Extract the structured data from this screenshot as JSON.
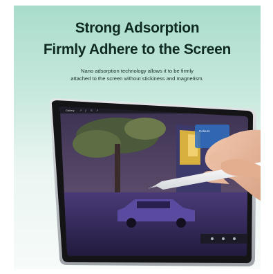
{
  "banner": {
    "headline_line1": "Strong Adsorption",
    "headline_line2": "Firmly Adhere to the Screen",
    "subtitle_line1": "Nano adsorption technology allows it to be firmly",
    "subtitle_line2": "attached to the screen without stickiness and magnetism."
  },
  "tablet_app": {
    "gallery_label": "Gallery",
    "colours_label": "Colours"
  },
  "colors": {
    "background_top": "#a9dccc",
    "background_bottom": "#f7fbfa",
    "headline_text": "#0f2a22",
    "tablet_frame": "#c9ccd0",
    "pencil": "#f4f5f6"
  },
  "icons": [
    "brush-icon",
    "smudge-icon",
    "eraser-icon",
    "layers-icon",
    "color-swatch-icon",
    "undo-icon"
  ]
}
